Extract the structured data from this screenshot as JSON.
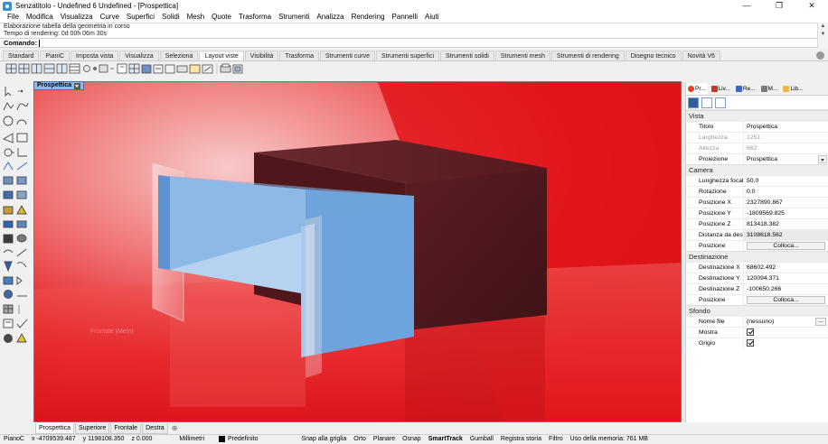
{
  "window": {
    "title": "Senzatitolo - Undefined 6 Undefined - [Prospettica]",
    "controls": {
      "minimize": "—",
      "maximize": "❐",
      "close": "✕"
    }
  },
  "menu": [
    "File",
    "Modifica",
    "Visualizza",
    "Curve",
    "Superfici",
    "Solidi",
    "Mesh",
    "Quote",
    "Trasforma",
    "Strumenti",
    "Analizza",
    "Rendering",
    "Pannelli",
    "Aiuti"
  ],
  "command": {
    "history": [
      "Elaborazione tabella della geometria in corso",
      "Tempo di rendering: 0d 00h 06m 30s"
    ],
    "prompt": "Comando:"
  },
  "tabs": [
    "Standard",
    "PianiC",
    "Imposta vista",
    "Visualizza",
    "Seleziona",
    "Layout viste",
    "Visibilità",
    "Trasforma",
    "Strumenti curve",
    "Strumenti superfici",
    "Strumenti solidi",
    "Strumenti mesh",
    "Strumenti di rendering",
    "Disegno tecnico",
    "Novità V6"
  ],
  "active_tab": "Layout viste",
  "viewport": {
    "label": "Prospettica",
    "faint_text": "Frontale (Metri)"
  },
  "viewport_tabs": [
    "Prospettica",
    "Superiore",
    "Frontale",
    "Destra"
  ],
  "viewport_tabs_add": "⊕",
  "panel": {
    "tabs": [
      "Pr...",
      "Liv...",
      "Re...",
      "M...",
      "Lib..."
    ],
    "sections": {
      "vista": "Vista",
      "camera": "Camera",
      "destinazione": "Destinazione",
      "sfondo": "Sfondo"
    },
    "vista": [
      {
        "label": "Titolo",
        "value": "Prospettica"
      },
      {
        "label": "Larghezza",
        "value": "1251"
      },
      {
        "label": "Altezza",
        "value": "662"
      },
      {
        "label": "Proiezione",
        "value": "Prospettica"
      }
    ],
    "camera": [
      {
        "label": "Lunghezza focale",
        "value": "50.0"
      },
      {
        "label": "Rotazione",
        "value": "0.0"
      },
      {
        "label": "Posizione X",
        "value": "2327890.867"
      },
      {
        "label": "Posizione Y",
        "value": "-1809569.825"
      },
      {
        "label": "Posizione Z",
        "value": "813418.382"
      },
      {
        "label": "Distanza da destin...",
        "value": "3108618.562"
      },
      {
        "label": "Posizione",
        "value": "Colloca..."
      }
    ],
    "destinazione": [
      {
        "label": "Destinazione X",
        "value": "68602.492"
      },
      {
        "label": "Destinazione Y",
        "value": "120094.371"
      },
      {
        "label": "Destinazione Z",
        "value": "-100650.266"
      },
      {
        "label": "Posizione",
        "value": "Colloca..."
      }
    ],
    "sfondo": [
      {
        "label": "Nome file",
        "value": "(nessuno)",
        "extra": "..."
      },
      {
        "label": "Mostra",
        "checked": true
      },
      {
        "label": "Grigio",
        "checked": true
      }
    ]
  },
  "status": {
    "plane": "PianoC",
    "x": "x -4709539.487",
    "y": "y 1198108.350",
    "z": "z 0.000",
    "units": "Millimetri",
    "layer": "Predefinito",
    "toggles": [
      "Snap alla griglia",
      "Orto",
      "Planare",
      "Osnap",
      "SmartTrack",
      "Gumball",
      "Registra storia",
      "Filtro"
    ],
    "bold_toggle": "SmartTrack",
    "memory": "Uso della memoria: 761 MB"
  },
  "colors": {
    "viewport_red": "#e8191f",
    "box_dark": "#5c1e22",
    "drawer_blue": "#7fb2e6"
  }
}
